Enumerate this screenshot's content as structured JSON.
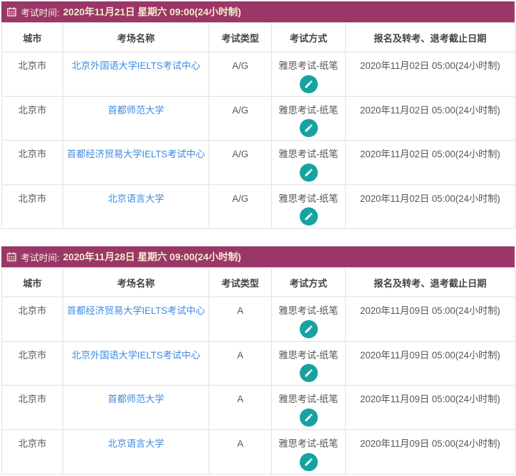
{
  "colors": {
    "header_bg": "#9a3768",
    "header_label_text": "#f7f3e0",
    "header_date_text": "#f3edca",
    "link_blue": "#3c8be0",
    "edit_button_teal": "#16a2a0",
    "table_border": "#e1e1e1",
    "body_text": "#555555"
  },
  "columns": [
    "城市",
    "考场名称",
    "考试类型",
    "考试方式",
    "报名及转考、退考截止日期"
  ],
  "icons": {
    "calendar": "calendar-icon",
    "pencil": "edit-pencil-icon"
  },
  "sections": [
    {
      "time_label": "考试时间:",
      "time_value": "2020年11月21日 星期六 09:00(24小时制)",
      "rows": [
        {
          "city": "北京市",
          "venue": "北京外国语大学IELTS考试中心",
          "type": "A/G",
          "method": "雅思考试-纸笔",
          "deadline": "2020年11月02日 05:00(24小时制)"
        },
        {
          "city": "北京市",
          "venue": "首都师范大学",
          "type": "A/G",
          "method": "雅思考试-纸笔",
          "deadline": "2020年11月02日 05:00(24小时制)"
        },
        {
          "city": "北京市",
          "venue": "首都经济贸易大学IELTS考试中心",
          "type": "A/G",
          "method": "雅思考试-纸笔",
          "deadline": "2020年11月02日 05:00(24小时制)"
        },
        {
          "city": "北京市",
          "venue": "北京语言大学",
          "type": "A/G",
          "method": "雅思考试-纸笔",
          "deadline": "2020年11月02日 05:00(24小时制)"
        }
      ]
    },
    {
      "time_label": "考试时间:",
      "time_value": "2020年11月28日 星期六 09:00(24小时制)",
      "rows": [
        {
          "city": "北京市",
          "venue": "首都经济贸易大学IELTS考试中心",
          "type": "A",
          "method": "雅思考试-纸笔",
          "deadline": "2020年11月09日 05:00(24小时制)"
        },
        {
          "city": "北京市",
          "venue": "北京外国语大学IELTS考试中心",
          "type": "A",
          "method": "雅思考试-纸笔",
          "deadline": "2020年11月09日 05:00(24小时制)"
        },
        {
          "city": "北京市",
          "venue": "首都师范大学",
          "type": "A",
          "method": "雅思考试-纸笔",
          "deadline": "2020年11月09日 05:00(24小时制)"
        },
        {
          "city": "北京市",
          "venue": "北京语言大学",
          "type": "A",
          "method": "雅思考试-纸笔",
          "deadline": "2020年11月09日 05:00(24小时制)"
        }
      ]
    }
  ]
}
